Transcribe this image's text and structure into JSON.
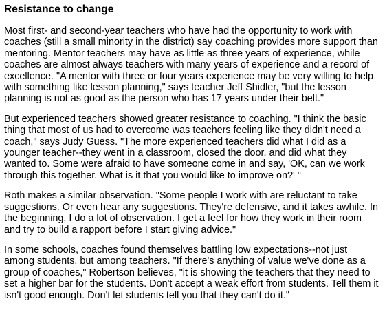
{
  "article": {
    "heading": "Resistance to change",
    "paragraphs": [
      "Most first- and second-year teachers who have had the opportunity to work with coaches (still a small minority in the district) say coaching provides more support than mentoring. Mentor teachers may have as little as three years of experience, while coaches are almost always teachers with many years of experience and a record of excellence. \"A mentor with three or four years experience may be very willing to help with something like lesson planning,\" says teacher Jeff Shidler, \"but the lesson planning is not as good as the person who has 17 years under their belt.\"",
      "But experienced teachers showed greater resistance to coaching. \"I think the basic thing that most of us had to overcome was teachers feeling like they didn't need a coach,\" says Judy Guess. \"The more experienced teachers did what I did as a younger teacher--they went in a classroom, closed the door, and did what they wanted to. Some were afraid to have someone come in and say, 'OK, can we work through this together. What is it that you would like to improve on?' \"",
      "Roth makes a similar observation. \"Some people I work with are reluctant to take suggestions. Or even hear any suggestions. They're defensive, and it takes awhile. In the beginning, I do a lot of observation. I get a feel for how they work in their room and try to build a rapport before I start giving advice.\"",
      "In some schools, coaches found themselves battling low expectations--not just among students, but among teachers. \"If there's anything of value we've done as a group of coaches,\" Robertson believes, \"it is showing the teachers that they need to set a higher bar for the students. Don't accept a weak effort from students. Tell them it isn't good enough. Don't let students tell you that they can't do it.\""
    ]
  }
}
